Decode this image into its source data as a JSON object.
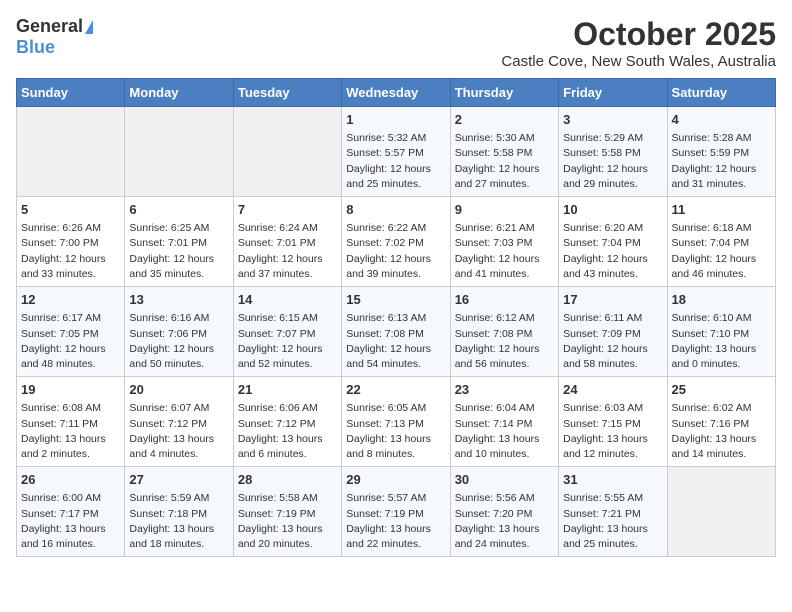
{
  "logo": {
    "general": "General",
    "blue": "Blue"
  },
  "title": "October 2025",
  "subtitle": "Castle Cove, New South Wales, Australia",
  "days_header": [
    "Sunday",
    "Monday",
    "Tuesday",
    "Wednesday",
    "Thursday",
    "Friday",
    "Saturday"
  ],
  "weeks": [
    [
      {
        "day": "",
        "content": ""
      },
      {
        "day": "",
        "content": ""
      },
      {
        "day": "",
        "content": ""
      },
      {
        "day": "1",
        "content": "Sunrise: 5:32 AM\nSunset: 5:57 PM\nDaylight: 12 hours\nand 25 minutes."
      },
      {
        "day": "2",
        "content": "Sunrise: 5:30 AM\nSunset: 5:58 PM\nDaylight: 12 hours\nand 27 minutes."
      },
      {
        "day": "3",
        "content": "Sunrise: 5:29 AM\nSunset: 5:58 PM\nDaylight: 12 hours\nand 29 minutes."
      },
      {
        "day": "4",
        "content": "Sunrise: 5:28 AM\nSunset: 5:59 PM\nDaylight: 12 hours\nand 31 minutes."
      }
    ],
    [
      {
        "day": "5",
        "content": "Sunrise: 6:26 AM\nSunset: 7:00 PM\nDaylight: 12 hours\nand 33 minutes."
      },
      {
        "day": "6",
        "content": "Sunrise: 6:25 AM\nSunset: 7:01 PM\nDaylight: 12 hours\nand 35 minutes."
      },
      {
        "day": "7",
        "content": "Sunrise: 6:24 AM\nSunset: 7:01 PM\nDaylight: 12 hours\nand 37 minutes."
      },
      {
        "day": "8",
        "content": "Sunrise: 6:22 AM\nSunset: 7:02 PM\nDaylight: 12 hours\nand 39 minutes."
      },
      {
        "day": "9",
        "content": "Sunrise: 6:21 AM\nSunset: 7:03 PM\nDaylight: 12 hours\nand 41 minutes."
      },
      {
        "day": "10",
        "content": "Sunrise: 6:20 AM\nSunset: 7:04 PM\nDaylight: 12 hours\nand 43 minutes."
      },
      {
        "day": "11",
        "content": "Sunrise: 6:18 AM\nSunset: 7:04 PM\nDaylight: 12 hours\nand 46 minutes."
      }
    ],
    [
      {
        "day": "12",
        "content": "Sunrise: 6:17 AM\nSunset: 7:05 PM\nDaylight: 12 hours\nand 48 minutes."
      },
      {
        "day": "13",
        "content": "Sunrise: 6:16 AM\nSunset: 7:06 PM\nDaylight: 12 hours\nand 50 minutes."
      },
      {
        "day": "14",
        "content": "Sunrise: 6:15 AM\nSunset: 7:07 PM\nDaylight: 12 hours\nand 52 minutes."
      },
      {
        "day": "15",
        "content": "Sunrise: 6:13 AM\nSunset: 7:08 PM\nDaylight: 12 hours\nand 54 minutes."
      },
      {
        "day": "16",
        "content": "Sunrise: 6:12 AM\nSunset: 7:08 PM\nDaylight: 12 hours\nand 56 minutes."
      },
      {
        "day": "17",
        "content": "Sunrise: 6:11 AM\nSunset: 7:09 PM\nDaylight: 12 hours\nand 58 minutes."
      },
      {
        "day": "18",
        "content": "Sunrise: 6:10 AM\nSunset: 7:10 PM\nDaylight: 13 hours\nand 0 minutes."
      }
    ],
    [
      {
        "day": "19",
        "content": "Sunrise: 6:08 AM\nSunset: 7:11 PM\nDaylight: 13 hours\nand 2 minutes."
      },
      {
        "day": "20",
        "content": "Sunrise: 6:07 AM\nSunset: 7:12 PM\nDaylight: 13 hours\nand 4 minutes."
      },
      {
        "day": "21",
        "content": "Sunrise: 6:06 AM\nSunset: 7:12 PM\nDaylight: 13 hours\nand 6 minutes."
      },
      {
        "day": "22",
        "content": "Sunrise: 6:05 AM\nSunset: 7:13 PM\nDaylight: 13 hours\nand 8 minutes."
      },
      {
        "day": "23",
        "content": "Sunrise: 6:04 AM\nSunset: 7:14 PM\nDaylight: 13 hours\nand 10 minutes."
      },
      {
        "day": "24",
        "content": "Sunrise: 6:03 AM\nSunset: 7:15 PM\nDaylight: 13 hours\nand 12 minutes."
      },
      {
        "day": "25",
        "content": "Sunrise: 6:02 AM\nSunset: 7:16 PM\nDaylight: 13 hours\nand 14 minutes."
      }
    ],
    [
      {
        "day": "26",
        "content": "Sunrise: 6:00 AM\nSunset: 7:17 PM\nDaylight: 13 hours\nand 16 minutes."
      },
      {
        "day": "27",
        "content": "Sunrise: 5:59 AM\nSunset: 7:18 PM\nDaylight: 13 hours\nand 18 minutes."
      },
      {
        "day": "28",
        "content": "Sunrise: 5:58 AM\nSunset: 7:19 PM\nDaylight: 13 hours\nand 20 minutes."
      },
      {
        "day": "29",
        "content": "Sunrise: 5:57 AM\nSunset: 7:19 PM\nDaylight: 13 hours\nand 22 minutes."
      },
      {
        "day": "30",
        "content": "Sunrise: 5:56 AM\nSunset: 7:20 PM\nDaylight: 13 hours\nand 24 minutes."
      },
      {
        "day": "31",
        "content": "Sunrise: 5:55 AM\nSunset: 7:21 PM\nDaylight: 13 hours\nand 25 minutes."
      },
      {
        "day": "",
        "content": ""
      }
    ]
  ]
}
